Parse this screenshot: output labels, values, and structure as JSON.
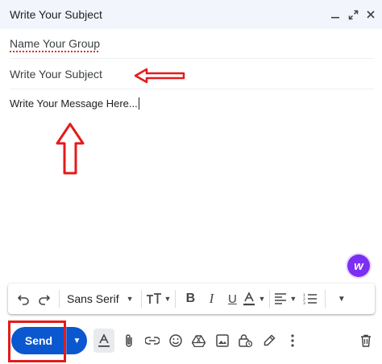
{
  "window": {
    "title": "Write Your Subject",
    "minimize_icon": "minimize-icon",
    "expand_icon": "expand-icon",
    "close_icon": "close-icon"
  },
  "recipients": {
    "value": "Name Your Group"
  },
  "subject": {
    "value": "Write Your Subject"
  },
  "message": {
    "value": "Write Your Message Here..."
  },
  "formatting": {
    "font_family": "Sans Serif",
    "items": [
      "undo",
      "redo",
      "font-family",
      "font-size",
      "bold",
      "italic",
      "underline",
      "text-color",
      "align",
      "numbered-list",
      "more-formatting"
    ]
  },
  "send": {
    "label": "Send"
  },
  "annotation_color": "#e41b1b",
  "send_color": "#0b57d0"
}
